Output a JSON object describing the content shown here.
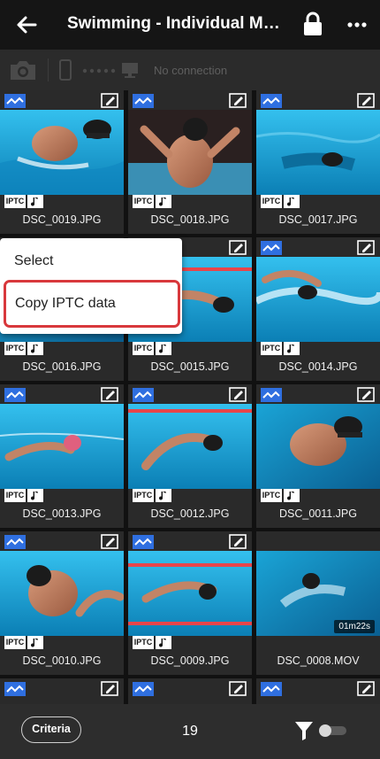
{
  "header": {
    "title": "Swimming - Individual Medley",
    "back_icon": "arrow-left-icon",
    "lock_icon": "lock-icon",
    "more_icon": "more-vertical-icon"
  },
  "connection": {
    "status": "No connection"
  },
  "photos": [
    {
      "filename": "DSC_0019.JPG",
      "badges": [
        "transfer",
        "edit",
        "IPTC",
        "voice-memo"
      ]
    },
    {
      "filename": "DSC_0018.JPG",
      "badges": [
        "transfer",
        "edit",
        "IPTC",
        "voice-memo"
      ]
    },
    {
      "filename": "DSC_0017.JPG",
      "badges": [
        "transfer",
        "edit",
        "IPTC",
        "voice-memo"
      ]
    },
    {
      "filename": "DSC_0016.JPG",
      "badges": [
        "IPTC",
        "voice-memo"
      ]
    },
    {
      "filename": "DSC_0015.JPG",
      "badges": [
        "edit",
        "IPTC",
        "voice-memo"
      ]
    },
    {
      "filename": "DSC_0014.JPG",
      "badges": [
        "transfer",
        "edit",
        "IPTC",
        "voice-memo"
      ]
    },
    {
      "filename": "DSC_0013.JPG",
      "badges": [
        "transfer",
        "edit",
        "IPTC",
        "voice-memo"
      ]
    },
    {
      "filename": "DSC_0012.JPG",
      "badges": [
        "transfer",
        "edit",
        "IPTC",
        "voice-memo"
      ]
    },
    {
      "filename": "DSC_0011.JPG",
      "badges": [
        "transfer",
        "edit",
        "IPTC",
        "voice-memo"
      ]
    },
    {
      "filename": "DSC_0010.JPG",
      "badges": [
        "transfer",
        "edit",
        "IPTC",
        "voice-memo"
      ]
    },
    {
      "filename": "DSC_0009.JPG",
      "badges": [
        "transfer",
        "edit",
        "IPTC",
        "voice-memo"
      ]
    },
    {
      "filename": "DSC_0008.MOV",
      "badges": [],
      "duration": "01m22s"
    }
  ],
  "badge_labels": {
    "iptc": "IPTC"
  },
  "context_menu": {
    "items": [
      "Select",
      "Copy IPTC data"
    ],
    "highlighted": "Copy IPTC data",
    "highlight_color": "#d8383c"
  },
  "bottom_bar": {
    "criteria_label": "Criteria",
    "count": "19",
    "filter_icon": "filter-icon",
    "toggle_state": "off"
  },
  "colors": {
    "background": "#1c1c1c",
    "header": "#151515",
    "transfer_badge": "#2f6fe0",
    "pool_water": "#19a6d8"
  }
}
